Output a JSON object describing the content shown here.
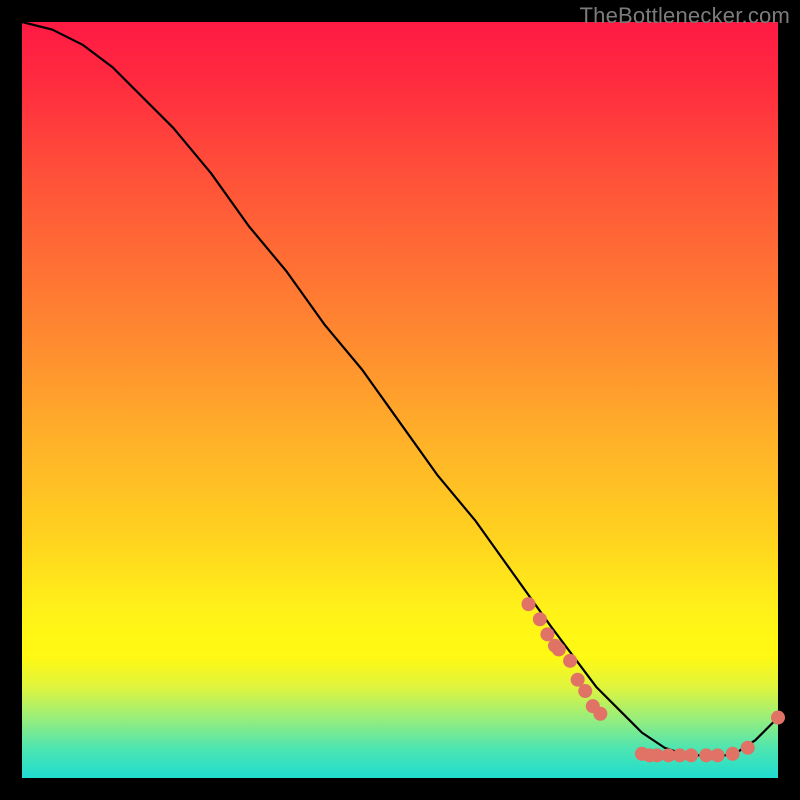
{
  "watermark": "TheBottlenecker.com",
  "colors": {
    "background": "#000000",
    "dot": "#e07366",
    "curve": "#000000"
  },
  "chart_data": {
    "type": "line",
    "title": "",
    "xlabel": "",
    "ylabel": "",
    "xlim": [
      0,
      100
    ],
    "ylim": [
      0,
      100
    ],
    "series": [
      {
        "name": "bottleneck-curve",
        "x": [
          0,
          4,
          8,
          12,
          16,
          20,
          25,
          30,
          35,
          40,
          45,
          50,
          55,
          60,
          65,
          70,
          73,
          76,
          79,
          82,
          85,
          88,
          91,
          94,
          97,
          100
        ],
        "y": [
          100,
          99,
          97,
          94,
          90,
          86,
          80,
          73,
          67,
          60,
          54,
          47,
          40,
          34,
          27,
          20,
          16,
          12,
          9,
          6,
          4,
          3,
          3,
          3,
          5,
          8
        ]
      }
    ],
    "markers": [
      {
        "x": 67,
        "y": 23
      },
      {
        "x": 68.5,
        "y": 21
      },
      {
        "x": 69.5,
        "y": 19
      },
      {
        "x": 70.5,
        "y": 17.5
      },
      {
        "x": 71,
        "y": 17
      },
      {
        "x": 72.5,
        "y": 15.5
      },
      {
        "x": 73.5,
        "y": 13
      },
      {
        "x": 74.5,
        "y": 11.5
      },
      {
        "x": 75.5,
        "y": 9.5
      },
      {
        "x": 76.5,
        "y": 8.5
      },
      {
        "x": 82,
        "y": 3.2
      },
      {
        "x": 83,
        "y": 3.0
      },
      {
        "x": 84,
        "y": 3.0
      },
      {
        "x": 85.5,
        "y": 3.0
      },
      {
        "x": 87,
        "y": 3.0
      },
      {
        "x": 88.5,
        "y": 3.0
      },
      {
        "x": 90.5,
        "y": 3.0
      },
      {
        "x": 92,
        "y": 3.0
      },
      {
        "x": 94,
        "y": 3.2
      },
      {
        "x": 96,
        "y": 4.0
      },
      {
        "x": 100,
        "y": 8.0
      }
    ]
  }
}
